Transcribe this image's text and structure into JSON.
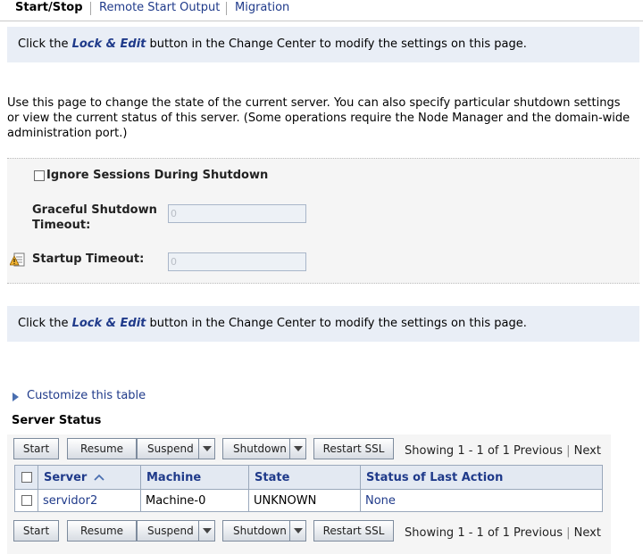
{
  "tabs": [
    {
      "label": "Start/Stop",
      "active": true
    },
    {
      "label": "Remote Start Output",
      "active": false
    },
    {
      "label": "Migration",
      "active": false
    }
  ],
  "banner": {
    "prefix": "Click the ",
    "lock_text": "Lock & Edit",
    "suffix": " button in the Change Center to modify the settings on this page."
  },
  "intro": "Use this page to change the state of the current server. You can also specify particular shutdown settings or view the current status of this server. (Some operations require the Node Manager and the domain-wide administration port.)",
  "form": {
    "ignore_sessions_label": "Ignore Sessions During Shutdown",
    "ignore_sessions_checked": false,
    "graceful_label": "Graceful Shutdown Timeout:",
    "graceful_value": "0",
    "startup_label": "Startup Timeout:",
    "startup_value": "0"
  },
  "customize_link": "Customize this table",
  "server_status": {
    "title": "Server Status",
    "buttons": {
      "start": "Start",
      "resume": "Resume",
      "suspend": "Suspend",
      "shutdown": "Shutdown",
      "restart_ssl": "Restart SSL"
    },
    "pager": {
      "showing": "Showing 1 - 1 of 1",
      "previous": "Previous",
      "next": "Next"
    },
    "columns": [
      "Server",
      "Machine",
      "State",
      "Status of Last Action"
    ],
    "rows": [
      {
        "server": "servidor2",
        "machine": "Machine-0",
        "state": "UNKNOWN",
        "last_action": "None"
      }
    ]
  },
  "colors": {
    "link": "#1f3a8a",
    "banner_bg": "#e9eef6",
    "header_bg": "#e3e9f2"
  }
}
